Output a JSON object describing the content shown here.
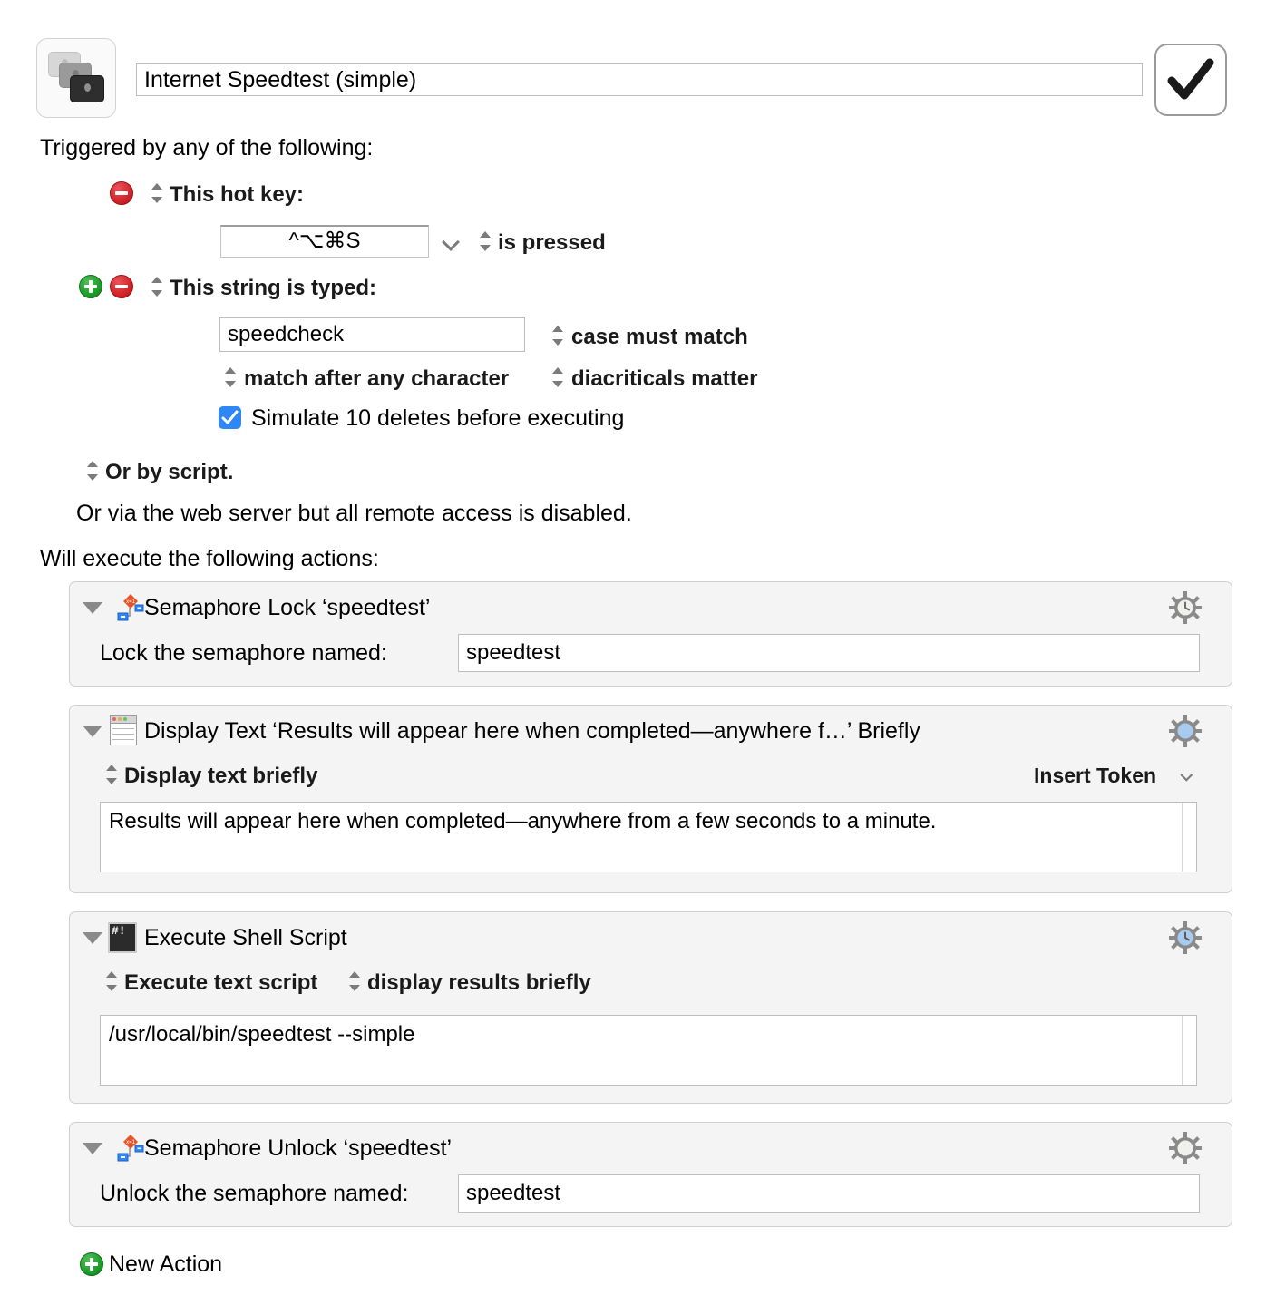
{
  "header": {
    "macro_icon": "keyboard-keys-stack-icon",
    "title_value": "Internet Speedtest (simple)",
    "title_placeholder": "Macro Name",
    "confirm_icon": "checkmark-icon"
  },
  "triggers": {
    "heading": "Triggered by any of the following:",
    "hotkey": {
      "label": "This hot key:",
      "value": "^⌥⌘S",
      "condition": "is pressed",
      "remove_label": "−"
    },
    "typed_string": {
      "label": "This string is typed:",
      "value": "speedcheck",
      "placeholder": "",
      "case_option": "case must match",
      "match_option": "match after any character",
      "diacritics_option": "diacriticals matter",
      "simulate_deletes_label": "Simulate 10 deletes before executing",
      "simulate_deletes_checked": true,
      "add_label": "+",
      "remove_label": "−"
    },
    "by_script": "Or by script.",
    "web_server_note": "Or via the web server but all remote access is disabled."
  },
  "actions_heading": "Will execute the following actions:",
  "actions": [
    {
      "icon": "semaphore-icon",
      "title": "Semaphore Lock ‘speedtest’",
      "gear": {
        "style": "gray-clock"
      },
      "field_label": "Lock the semaphore named:",
      "field_value": "speedtest"
    },
    {
      "icon": "display-text-window-icon",
      "title": "Display Text ‘Results will appear here when completed—anywhere f…’ Briefly",
      "gear": {
        "style": "blue-plain"
      },
      "mode_label": "Display text briefly",
      "insert_token_label": "Insert Token",
      "text_value": "Results will appear here when completed—anywhere from a few seconds to a minute."
    },
    {
      "icon": "shell-script-icon",
      "title": "Execute Shell Script",
      "gear": {
        "style": "blue-clock"
      },
      "mode_label": "Execute text script",
      "display_label": "display results briefly",
      "script_value": "/usr/local/bin/speedtest --simple"
    },
    {
      "icon": "semaphore-icon",
      "title": "Semaphore Unlock ‘speedtest’",
      "gear": {
        "style": "gray-plain"
      },
      "field_label": "Unlock the semaphore named:",
      "field_value": "speedtest"
    }
  ],
  "new_action": {
    "label": "New Action",
    "icon": "plus-circle-icon"
  },
  "colors": {
    "accent_blue": "#2f87f6",
    "remove_red": "#d2232a",
    "add_green": "#1d9c2c",
    "panel_bg": "#f4f4f4",
    "gear_gray": "#8a8a8a",
    "gear_blue": "#a8cbf0"
  }
}
